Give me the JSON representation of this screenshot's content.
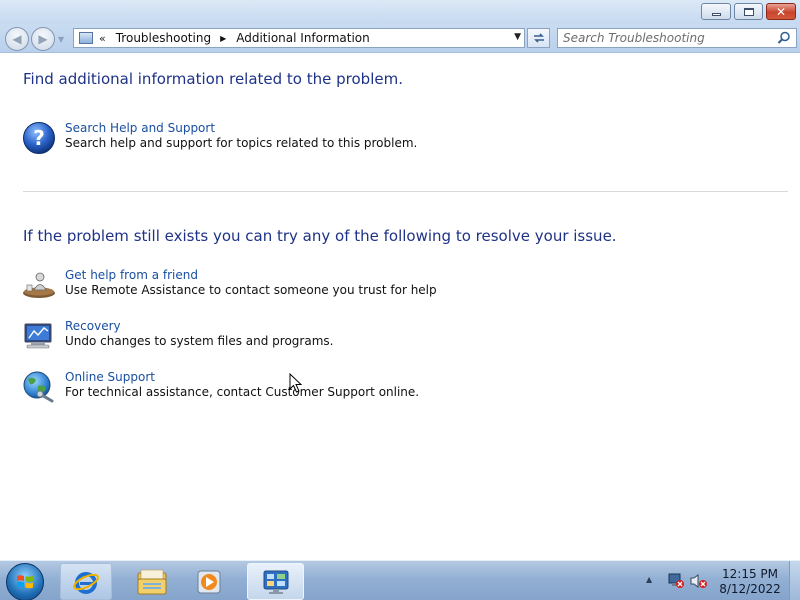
{
  "window": {
    "address": {
      "crumbs": [
        "Troubleshooting",
        "Additional Information"
      ]
    },
    "search": {
      "placeholder": "Search Troubleshooting"
    }
  },
  "main": {
    "heading1": "Find additional information related to the problem.",
    "heading2": "If the problem still exists you can try any of the following to resolve your issue.",
    "tasks": [
      {
        "title": "Search Help and Support",
        "description": "Search help and support for topics related to this problem.",
        "icon": "help-icon"
      },
      {
        "title": "Get help from a friend",
        "description": "Use Remote Assistance to contact someone you trust for help",
        "icon": "remote-assistance-icon"
      },
      {
        "title": "Recovery",
        "description": "Undo changes to system files and programs.",
        "icon": "recovery-icon"
      },
      {
        "title": "Online Support",
        "description": "For technical assistance, contact Customer Support online.",
        "icon": "globe-icon"
      }
    ]
  },
  "taskbar": {
    "clock": {
      "time": "12:15 PM",
      "date": "8/12/2022"
    }
  },
  "colors": {
    "heading": "#1e3287",
    "link": "#1a4fa0"
  }
}
